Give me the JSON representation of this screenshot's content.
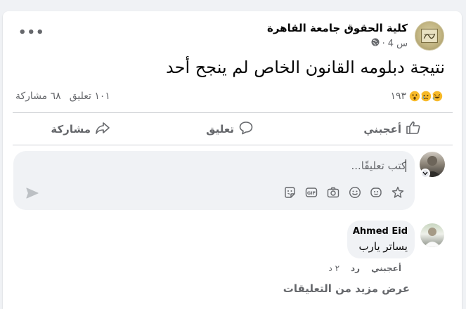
{
  "post": {
    "page_name": "كلية الحقوق جامعة القاهرة",
    "time": "4 س",
    "separator": "·",
    "privacy_icon": "globe-icon",
    "more_icon": "more-dots-icon",
    "more_label": "•••",
    "text": "نتيجة دبلومه القانون الخاص لم ينجح أحد"
  },
  "reactions": {
    "icons": [
      "haha-emoji",
      "sad-emoji",
      "wow-emoji"
    ],
    "count": "١٩٣",
    "comments": "١٠١ تعليق",
    "shares": "٦٨ مشاركة"
  },
  "actions": {
    "like": "أعجبني",
    "comment": "تعليق",
    "share": "مشاركة"
  },
  "composer": {
    "placeholder": "كتب تعليقًا...",
    "tools": [
      "sticker-icon",
      "gif-icon",
      "camera-icon",
      "emoji-icon",
      "avatar-sticker-icon",
      "star-icon"
    ],
    "gif_label": "GIF",
    "send_icon": "send-icon"
  },
  "comment": {
    "author": "Ahmed Eid",
    "text": "يساتر يارب",
    "like": "أعجبني",
    "reply": "رد",
    "time": "٢ د"
  },
  "more_comments": "عرض مزيد من التعليقات",
  "colors": {
    "secondary_text": "#65676b",
    "divider": "#ced0d4",
    "bubble": "#f0f2f5",
    "reaction_yellow": "#f7b928"
  }
}
